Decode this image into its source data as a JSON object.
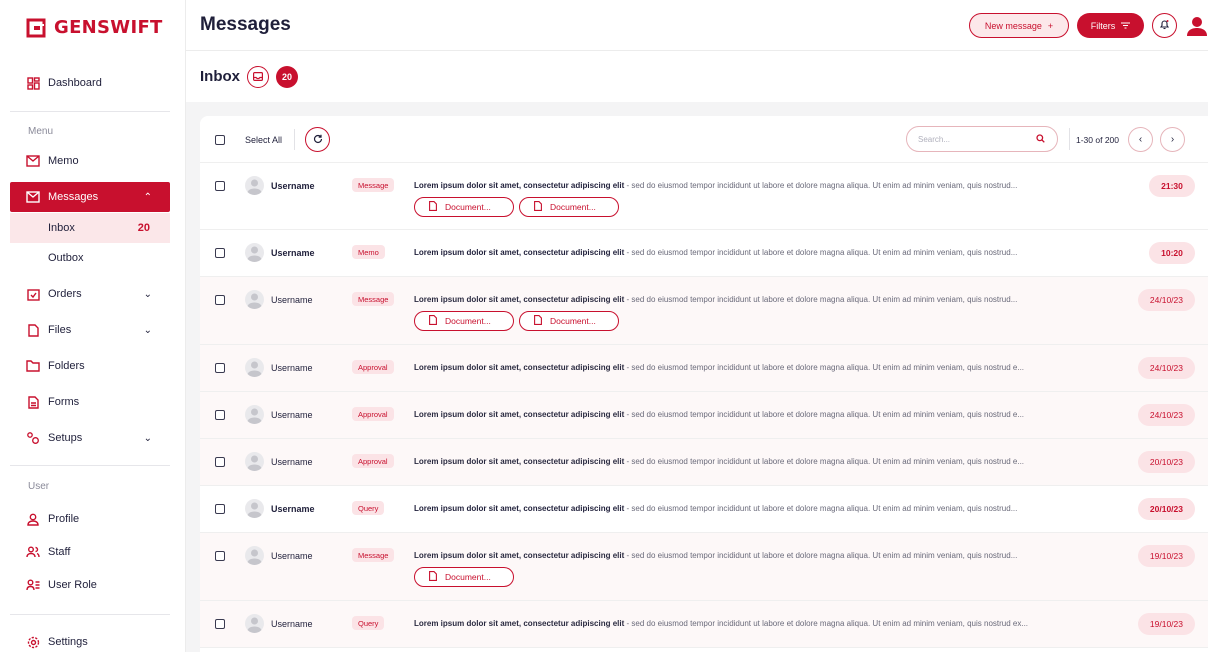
{
  "brand": {
    "name": "GENSWIFT",
    "accent": "#c8102e"
  },
  "sidebar": {
    "dashboard": "Dashboard",
    "menu_label": "Menu",
    "memo": "Memo",
    "messages": "Messages",
    "inbox": "Inbox",
    "inbox_count": "20",
    "outbox": "Outbox",
    "orders": "Orders",
    "files": "Files",
    "folders": "Folders",
    "forms": "Forms",
    "setups": "Setups",
    "user_label": "User",
    "profile": "Profile",
    "staff": "Staff",
    "user_role": "User Role",
    "settings": "Settings"
  },
  "header": {
    "title": "Messages",
    "new_message": "New message",
    "new_message_icon": "+",
    "filters": "Filters"
  },
  "subheader": {
    "title": "Inbox",
    "count": "20"
  },
  "toolbar": {
    "select_all": "Select All",
    "search_placeholder": "Search...",
    "pagination": "1-30 of 200",
    "prev": "‹",
    "next": "›"
  },
  "messages": [
    {
      "user": "Username",
      "tag": "Message",
      "lead": "Lorem ipsum dolor sit amet, consectetur adipiscing elit",
      "body": " - sed do eiusmod tempor incididunt ut labore et dolore magna aliqua. Ut enim ad minim veniam, quis nostrud...",
      "time": "21:30",
      "docs": [
        "Document...",
        "Document..."
      ]
    },
    {
      "user": "Username",
      "tag": "Memo",
      "lead": "Lorem ipsum dolor sit amet, consectetur adipiscing elit",
      "body": " - sed do eiusmod tempor incididunt ut labore et dolore magna aliqua. Ut enim ad minim veniam, quis nostrud...",
      "time": "10:20",
      "docs": []
    },
    {
      "user": "Username",
      "tag": "Message",
      "lead": "Lorem ipsum dolor sit amet, consectetur adipiscing elit",
      "body": " - sed do eiusmod tempor incididunt ut labore et dolore magna aliqua. Ut enim ad minim veniam, quis nostrud...",
      "time": "24/10/23",
      "docs": [
        "Document...",
        "Document..."
      ]
    },
    {
      "user": "Username",
      "tag": "Approval",
      "lead": "Lorem ipsum dolor sit amet, consectetur adipiscing elit",
      "body": " - sed do eiusmod tempor incididunt ut labore et dolore magna aliqua. Ut enim ad minim veniam, quis nostrud e...",
      "time": "24/10/23",
      "docs": []
    },
    {
      "user": "Username",
      "tag": "Approval",
      "lead": "Lorem ipsum dolor sit amet, consectetur adipiscing elit",
      "body": " - sed do eiusmod tempor incididunt ut labore et dolore magna aliqua. Ut enim ad minim veniam, quis nostrud e...",
      "time": "24/10/23",
      "docs": []
    },
    {
      "user": "Username",
      "tag": "Approval",
      "lead": "Lorem ipsum dolor sit amet, consectetur adipiscing elit",
      "body": " - sed do eiusmod tempor incididunt ut labore et dolore magna aliqua. Ut enim ad minim veniam, quis nostrud e...",
      "time": "20/10/23",
      "docs": []
    },
    {
      "user": "Username",
      "tag": "Query",
      "lead": "Lorem ipsum dolor sit amet, consectetur adipiscing elit",
      "body": " - sed do eiusmod tempor incididunt ut labore et dolore magna aliqua. Ut enim ad minim veniam, quis nostrud...",
      "time": "20/10/23",
      "docs": []
    },
    {
      "user": "Username",
      "tag": "Message",
      "lead": "Lorem ipsum dolor sit amet, consectetur adipiscing elit",
      "body": " - sed do eiusmod tempor incididunt ut labore et dolore magna aliqua. Ut enim ad minim veniam, quis nostrud...",
      "time": "19/10/23",
      "docs": [
        "Document..."
      ]
    },
    {
      "user": "Username",
      "tag": "Query",
      "lead": "Lorem ipsum dolor sit amet, consectetur adipiscing elit",
      "body": " - sed do eiusmod tempor incididunt ut labore et dolore magna aliqua. Ut enim ad minim veniam, quis nostrud ex...",
      "time": "19/10/23",
      "docs": []
    }
  ]
}
